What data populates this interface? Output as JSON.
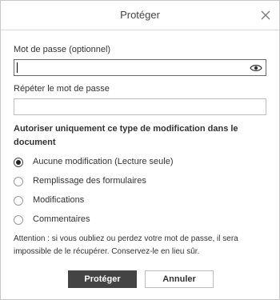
{
  "dialog": {
    "title": "Protéger",
    "close_icon": "close-icon"
  },
  "password": {
    "label": "Mot de passe (optionnel)",
    "value": "",
    "placeholder": "",
    "toggle_icon": "eye-icon"
  },
  "repeat_password": {
    "label": "Répéter le mot de passe",
    "value": "",
    "placeholder": ""
  },
  "permissions": {
    "heading": "Autoriser uniquement ce type de modification dans le document",
    "options": [
      {
        "label": "Aucune modification (Lecture seule)",
        "checked": true
      },
      {
        "label": "Remplissage des formulaires",
        "checked": false
      },
      {
        "label": "Modifications",
        "checked": false
      },
      {
        "label": "Commentaires",
        "checked": false
      }
    ]
  },
  "notice": "Attention : si vous oubliez ou perdez votre mot de passe, il sera impossible de le récupérer. Conservez-le en lieu sûr.",
  "buttons": {
    "protect": "Protéger",
    "cancel": "Annuler"
  },
  "colors": {
    "primary_button": "#444444",
    "border": "#bdbdbd"
  }
}
